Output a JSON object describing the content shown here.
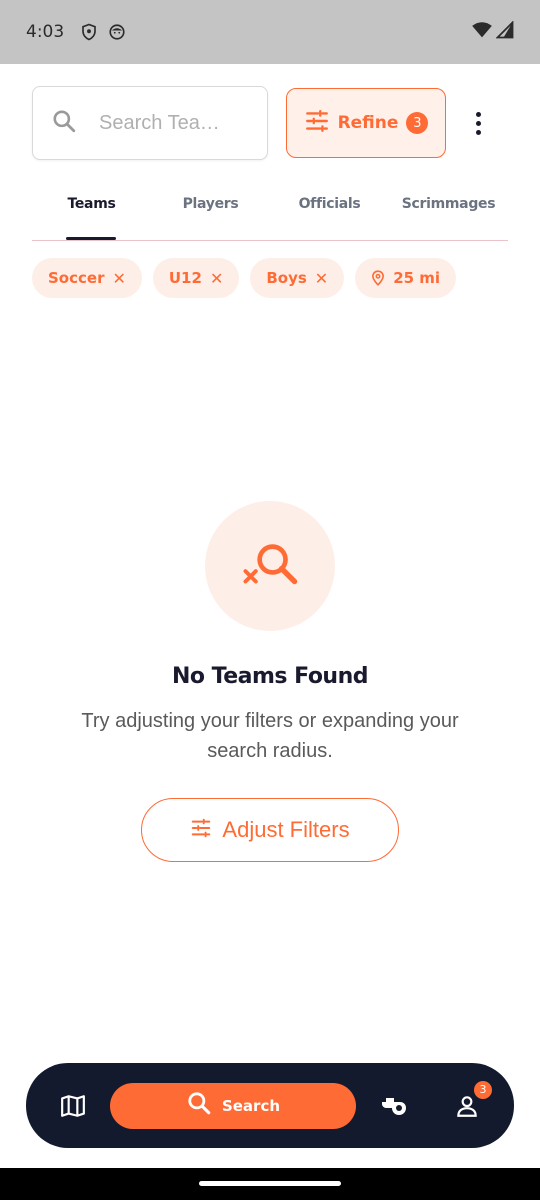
{
  "status_bar": {
    "time": "4:03"
  },
  "search": {
    "placeholder": "Search Tea…"
  },
  "refine": {
    "label": "Refine",
    "count": "3"
  },
  "tabs": [
    {
      "label": "Teams",
      "active": true
    },
    {
      "label": "Players",
      "active": false
    },
    {
      "label": "Officials",
      "active": false
    },
    {
      "label": "Scrimmages",
      "active": false
    }
  ],
  "chips": [
    {
      "label": "Soccer",
      "close": "✕"
    },
    {
      "label": "U12",
      "close": "✕"
    },
    {
      "label": "Boys",
      "close": "✕"
    },
    {
      "label": "25 mi"
    }
  ],
  "empty_state": {
    "title": "No Teams Found",
    "description": "Try adjusting your filters or expanding your search radius.",
    "button_label": "Adjust Filters"
  },
  "bottom_nav": {
    "search_label": "Search",
    "profile_badge": "3"
  },
  "colors": {
    "accent": "#ff6b35",
    "accent_light": "#fdeee8",
    "navy": "#131a2d"
  },
  "icons": [
    "shield-icon",
    "face-icon",
    "wifi-icon",
    "signal-icon",
    "search-icon",
    "tune-icon",
    "more-vert-icon",
    "close-icon",
    "location-pin-icon",
    "search-off-icon",
    "map-icon",
    "whistle-icon",
    "person-icon"
  ]
}
